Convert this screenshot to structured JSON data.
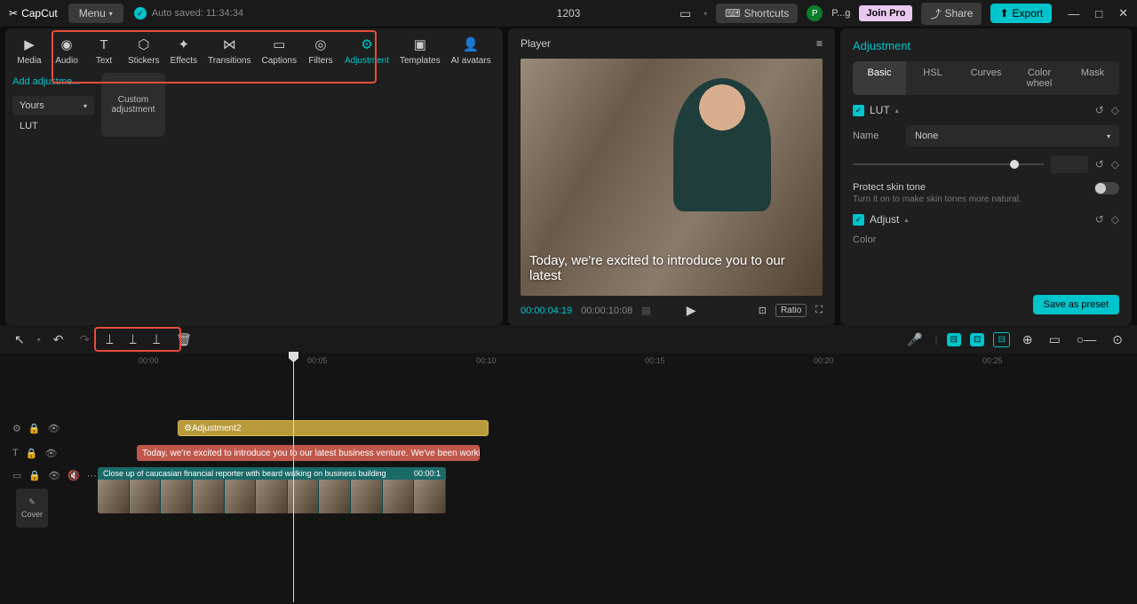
{
  "titlebar": {
    "app": "CapCut",
    "menu": "Menu",
    "autosave": "Auto saved: 11:34:34",
    "project": "1203",
    "shortcuts": "Shortcuts",
    "profile": "P...g",
    "joinpro": "Join Pro",
    "share": "Share",
    "export": "Export"
  },
  "tools": {
    "media": "Media",
    "audio": "Audio",
    "text": "Text",
    "stickers": "Stickers",
    "effects": "Effects",
    "transitions": "Transitions",
    "captions": "Captions",
    "filters": "Filters",
    "adjustment": "Adjustment",
    "templates": "Templates",
    "avatars": "AI avatars"
  },
  "left": {
    "add": "Add adjustme...",
    "yours": "Yours",
    "lut": "LUT",
    "custom": "Custom adjustment"
  },
  "player": {
    "title": "Player",
    "subtitle": "Today, we're excited to introduce you to our latest",
    "current": "00:00:04:19",
    "duration": "00:00:10:08",
    "ratio": "Ratio"
  },
  "adjust": {
    "title": "Adjustment",
    "tabs": {
      "basic": "Basic",
      "hsl": "HSL",
      "curves": "Curves",
      "colorwheel": "Color wheel",
      "mask": "Mask"
    },
    "lut": "LUT",
    "name_label": "Name",
    "name_value": "None",
    "protect": "Protect skin tone",
    "protect_sub": "Turn it on to make skin tones more natural.",
    "adjust_sec": "Adjust",
    "color": "Color",
    "save": "Save as preset"
  },
  "ruler": {
    "m0": "00:00",
    "m5": "00:05",
    "m10": "00:10",
    "m15": "00:15",
    "m20": "00:20",
    "m25": "00:25"
  },
  "timeline": {
    "cover": "Cover",
    "adj_clip": "Adjustment2",
    "sub_clip": "Today, we're excited to introduce you to our latest business venture. We've been workin",
    "vid_clip": "Close up of caucasian financial reporter with beard walking on business building",
    "vid_time": "00:00:1"
  }
}
